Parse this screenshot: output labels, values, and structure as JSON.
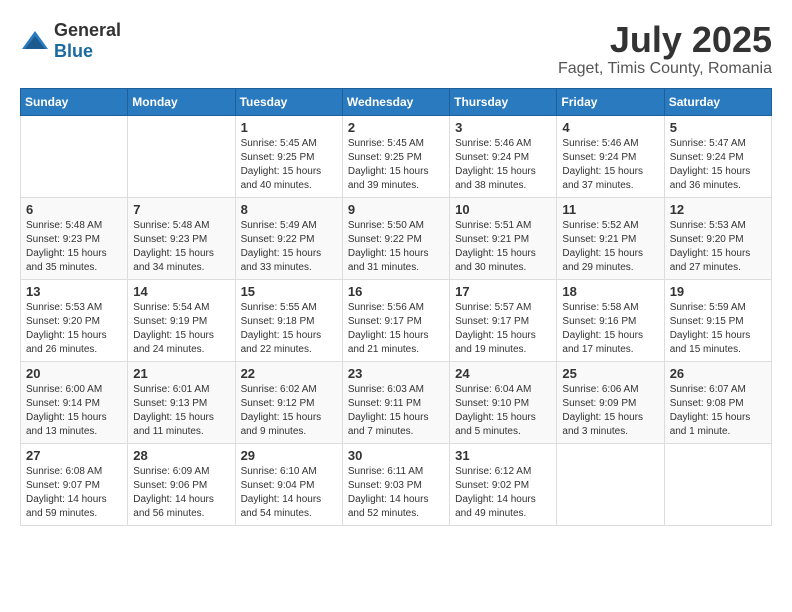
{
  "header": {
    "logo_general": "General",
    "logo_blue": "Blue",
    "month": "July 2025",
    "location": "Faget, Timis County, Romania"
  },
  "weekdays": [
    "Sunday",
    "Monday",
    "Tuesday",
    "Wednesday",
    "Thursday",
    "Friday",
    "Saturday"
  ],
  "weeks": [
    [
      {
        "day": "",
        "sunrise": "",
        "sunset": "",
        "daylight": ""
      },
      {
        "day": "",
        "sunrise": "",
        "sunset": "",
        "daylight": ""
      },
      {
        "day": "1",
        "sunrise": "Sunrise: 5:45 AM",
        "sunset": "Sunset: 9:25 PM",
        "daylight": "Daylight: 15 hours and 40 minutes."
      },
      {
        "day": "2",
        "sunrise": "Sunrise: 5:45 AM",
        "sunset": "Sunset: 9:25 PM",
        "daylight": "Daylight: 15 hours and 39 minutes."
      },
      {
        "day": "3",
        "sunrise": "Sunrise: 5:46 AM",
        "sunset": "Sunset: 9:24 PM",
        "daylight": "Daylight: 15 hours and 38 minutes."
      },
      {
        "day": "4",
        "sunrise": "Sunrise: 5:46 AM",
        "sunset": "Sunset: 9:24 PM",
        "daylight": "Daylight: 15 hours and 37 minutes."
      },
      {
        "day": "5",
        "sunrise": "Sunrise: 5:47 AM",
        "sunset": "Sunset: 9:24 PM",
        "daylight": "Daylight: 15 hours and 36 minutes."
      }
    ],
    [
      {
        "day": "6",
        "sunrise": "Sunrise: 5:48 AM",
        "sunset": "Sunset: 9:23 PM",
        "daylight": "Daylight: 15 hours and 35 minutes."
      },
      {
        "day": "7",
        "sunrise": "Sunrise: 5:48 AM",
        "sunset": "Sunset: 9:23 PM",
        "daylight": "Daylight: 15 hours and 34 minutes."
      },
      {
        "day": "8",
        "sunrise": "Sunrise: 5:49 AM",
        "sunset": "Sunset: 9:22 PM",
        "daylight": "Daylight: 15 hours and 33 minutes."
      },
      {
        "day": "9",
        "sunrise": "Sunrise: 5:50 AM",
        "sunset": "Sunset: 9:22 PM",
        "daylight": "Daylight: 15 hours and 31 minutes."
      },
      {
        "day": "10",
        "sunrise": "Sunrise: 5:51 AM",
        "sunset": "Sunset: 9:21 PM",
        "daylight": "Daylight: 15 hours and 30 minutes."
      },
      {
        "day": "11",
        "sunrise": "Sunrise: 5:52 AM",
        "sunset": "Sunset: 9:21 PM",
        "daylight": "Daylight: 15 hours and 29 minutes."
      },
      {
        "day": "12",
        "sunrise": "Sunrise: 5:53 AM",
        "sunset": "Sunset: 9:20 PM",
        "daylight": "Daylight: 15 hours and 27 minutes."
      }
    ],
    [
      {
        "day": "13",
        "sunrise": "Sunrise: 5:53 AM",
        "sunset": "Sunset: 9:20 PM",
        "daylight": "Daylight: 15 hours and 26 minutes."
      },
      {
        "day": "14",
        "sunrise": "Sunrise: 5:54 AM",
        "sunset": "Sunset: 9:19 PM",
        "daylight": "Daylight: 15 hours and 24 minutes."
      },
      {
        "day": "15",
        "sunrise": "Sunrise: 5:55 AM",
        "sunset": "Sunset: 9:18 PM",
        "daylight": "Daylight: 15 hours and 22 minutes."
      },
      {
        "day": "16",
        "sunrise": "Sunrise: 5:56 AM",
        "sunset": "Sunset: 9:17 PM",
        "daylight": "Daylight: 15 hours and 21 minutes."
      },
      {
        "day": "17",
        "sunrise": "Sunrise: 5:57 AM",
        "sunset": "Sunset: 9:17 PM",
        "daylight": "Daylight: 15 hours and 19 minutes."
      },
      {
        "day": "18",
        "sunrise": "Sunrise: 5:58 AM",
        "sunset": "Sunset: 9:16 PM",
        "daylight": "Daylight: 15 hours and 17 minutes."
      },
      {
        "day": "19",
        "sunrise": "Sunrise: 5:59 AM",
        "sunset": "Sunset: 9:15 PM",
        "daylight": "Daylight: 15 hours and 15 minutes."
      }
    ],
    [
      {
        "day": "20",
        "sunrise": "Sunrise: 6:00 AM",
        "sunset": "Sunset: 9:14 PM",
        "daylight": "Daylight: 15 hours and 13 minutes."
      },
      {
        "day": "21",
        "sunrise": "Sunrise: 6:01 AM",
        "sunset": "Sunset: 9:13 PM",
        "daylight": "Daylight: 15 hours and 11 minutes."
      },
      {
        "day": "22",
        "sunrise": "Sunrise: 6:02 AM",
        "sunset": "Sunset: 9:12 PM",
        "daylight": "Daylight: 15 hours and 9 minutes."
      },
      {
        "day": "23",
        "sunrise": "Sunrise: 6:03 AM",
        "sunset": "Sunset: 9:11 PM",
        "daylight": "Daylight: 15 hours and 7 minutes."
      },
      {
        "day": "24",
        "sunrise": "Sunrise: 6:04 AM",
        "sunset": "Sunset: 9:10 PM",
        "daylight": "Daylight: 15 hours and 5 minutes."
      },
      {
        "day": "25",
        "sunrise": "Sunrise: 6:06 AM",
        "sunset": "Sunset: 9:09 PM",
        "daylight": "Daylight: 15 hours and 3 minutes."
      },
      {
        "day": "26",
        "sunrise": "Sunrise: 6:07 AM",
        "sunset": "Sunset: 9:08 PM",
        "daylight": "Daylight: 15 hours and 1 minute."
      }
    ],
    [
      {
        "day": "27",
        "sunrise": "Sunrise: 6:08 AM",
        "sunset": "Sunset: 9:07 PM",
        "daylight": "Daylight: 14 hours and 59 minutes."
      },
      {
        "day": "28",
        "sunrise": "Sunrise: 6:09 AM",
        "sunset": "Sunset: 9:06 PM",
        "daylight": "Daylight: 14 hours and 56 minutes."
      },
      {
        "day": "29",
        "sunrise": "Sunrise: 6:10 AM",
        "sunset": "Sunset: 9:04 PM",
        "daylight": "Daylight: 14 hours and 54 minutes."
      },
      {
        "day": "30",
        "sunrise": "Sunrise: 6:11 AM",
        "sunset": "Sunset: 9:03 PM",
        "daylight": "Daylight: 14 hours and 52 minutes."
      },
      {
        "day": "31",
        "sunrise": "Sunrise: 6:12 AM",
        "sunset": "Sunset: 9:02 PM",
        "daylight": "Daylight: 14 hours and 49 minutes."
      },
      {
        "day": "",
        "sunrise": "",
        "sunset": "",
        "daylight": ""
      },
      {
        "day": "",
        "sunrise": "",
        "sunset": "",
        "daylight": ""
      }
    ]
  ]
}
